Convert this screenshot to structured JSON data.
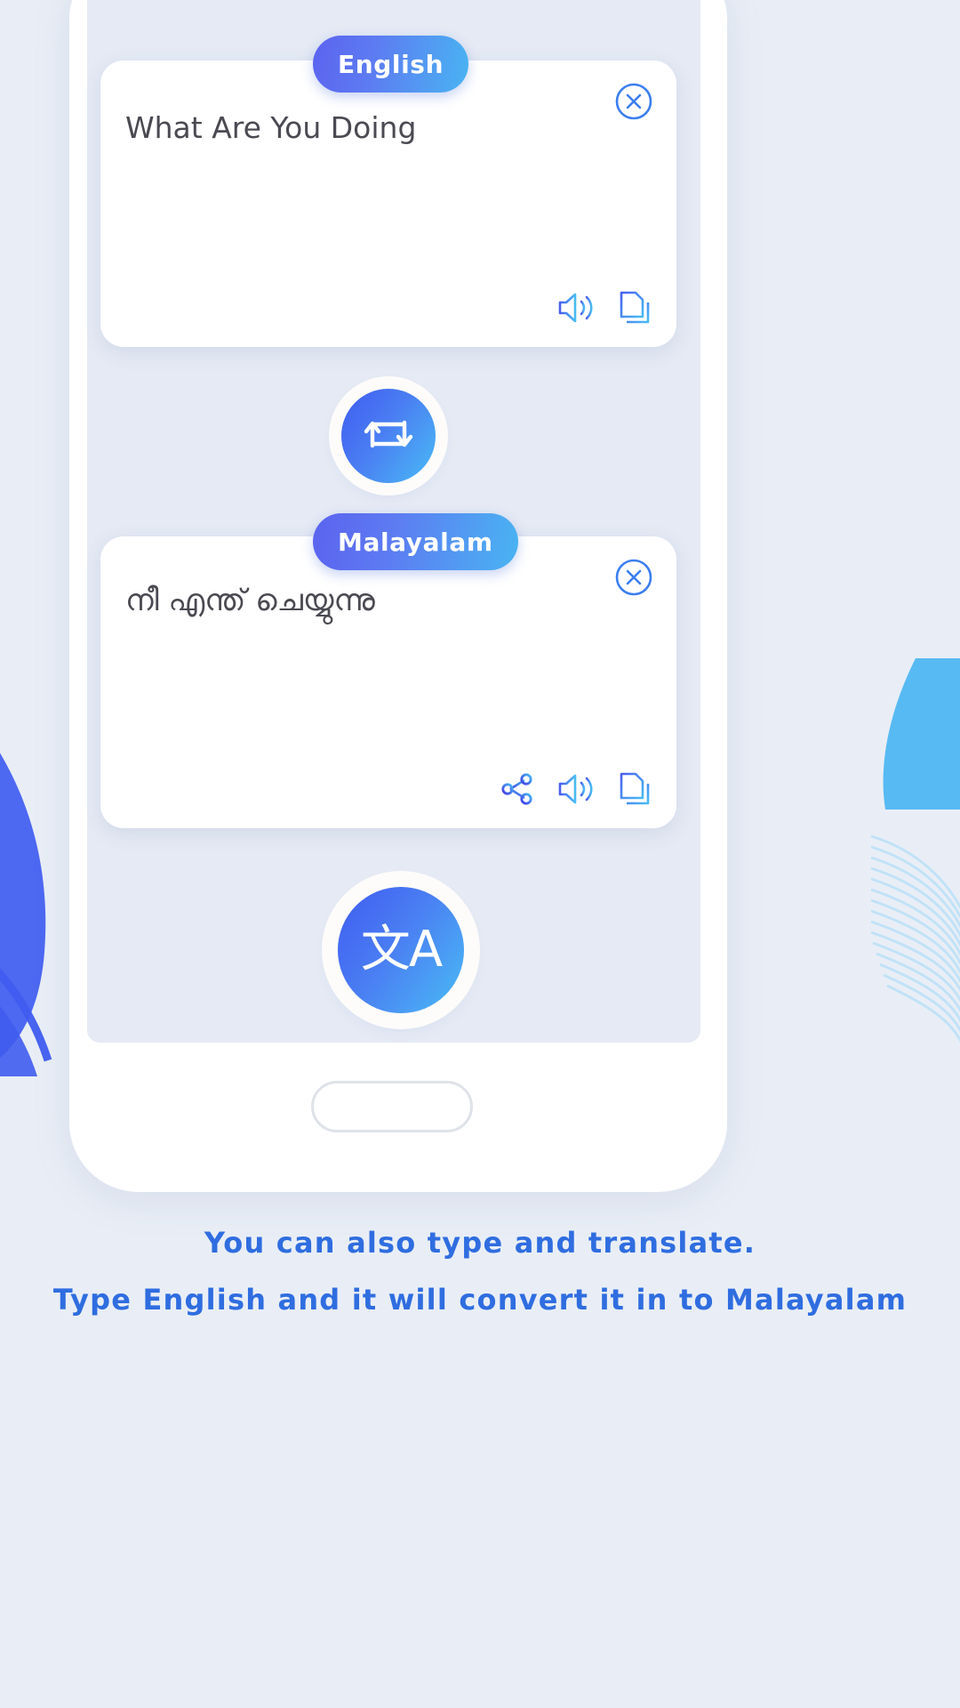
{
  "app": {
    "background_color": "#e9eef6",
    "accent_start": "#5b63ef",
    "accent_end": "#49b4f2",
    "footer_text_color": "#2f6de0"
  },
  "source_card": {
    "language_label": "English",
    "text": "What Are You Doing",
    "close_icon": "close-circle-icon",
    "actions": [
      {
        "icon": "speaker-icon",
        "name": "speak-source-button"
      },
      {
        "icon": "copy-icon",
        "name": "copy-source-button"
      }
    ]
  },
  "swap": {
    "icon": "swap-languages-icon",
    "name": "swap-languages-button"
  },
  "target_card": {
    "language_label": "Malayalam",
    "text": "നീ എന്ത് ചെയ്യുന്നു",
    "close_icon": "close-circle-icon",
    "actions": [
      {
        "icon": "share-icon",
        "name": "share-translation-button"
      },
      {
        "icon": "speaker-icon",
        "name": "speak-translation-button"
      },
      {
        "icon": "copy-icon",
        "name": "copy-translation-button"
      }
    ]
  },
  "translate_button": {
    "glyph": "文A",
    "name": "translate-button"
  },
  "footer": {
    "line1": "You can also type and translate.",
    "line2": "Type English and it will convert it in to Malayalam"
  }
}
